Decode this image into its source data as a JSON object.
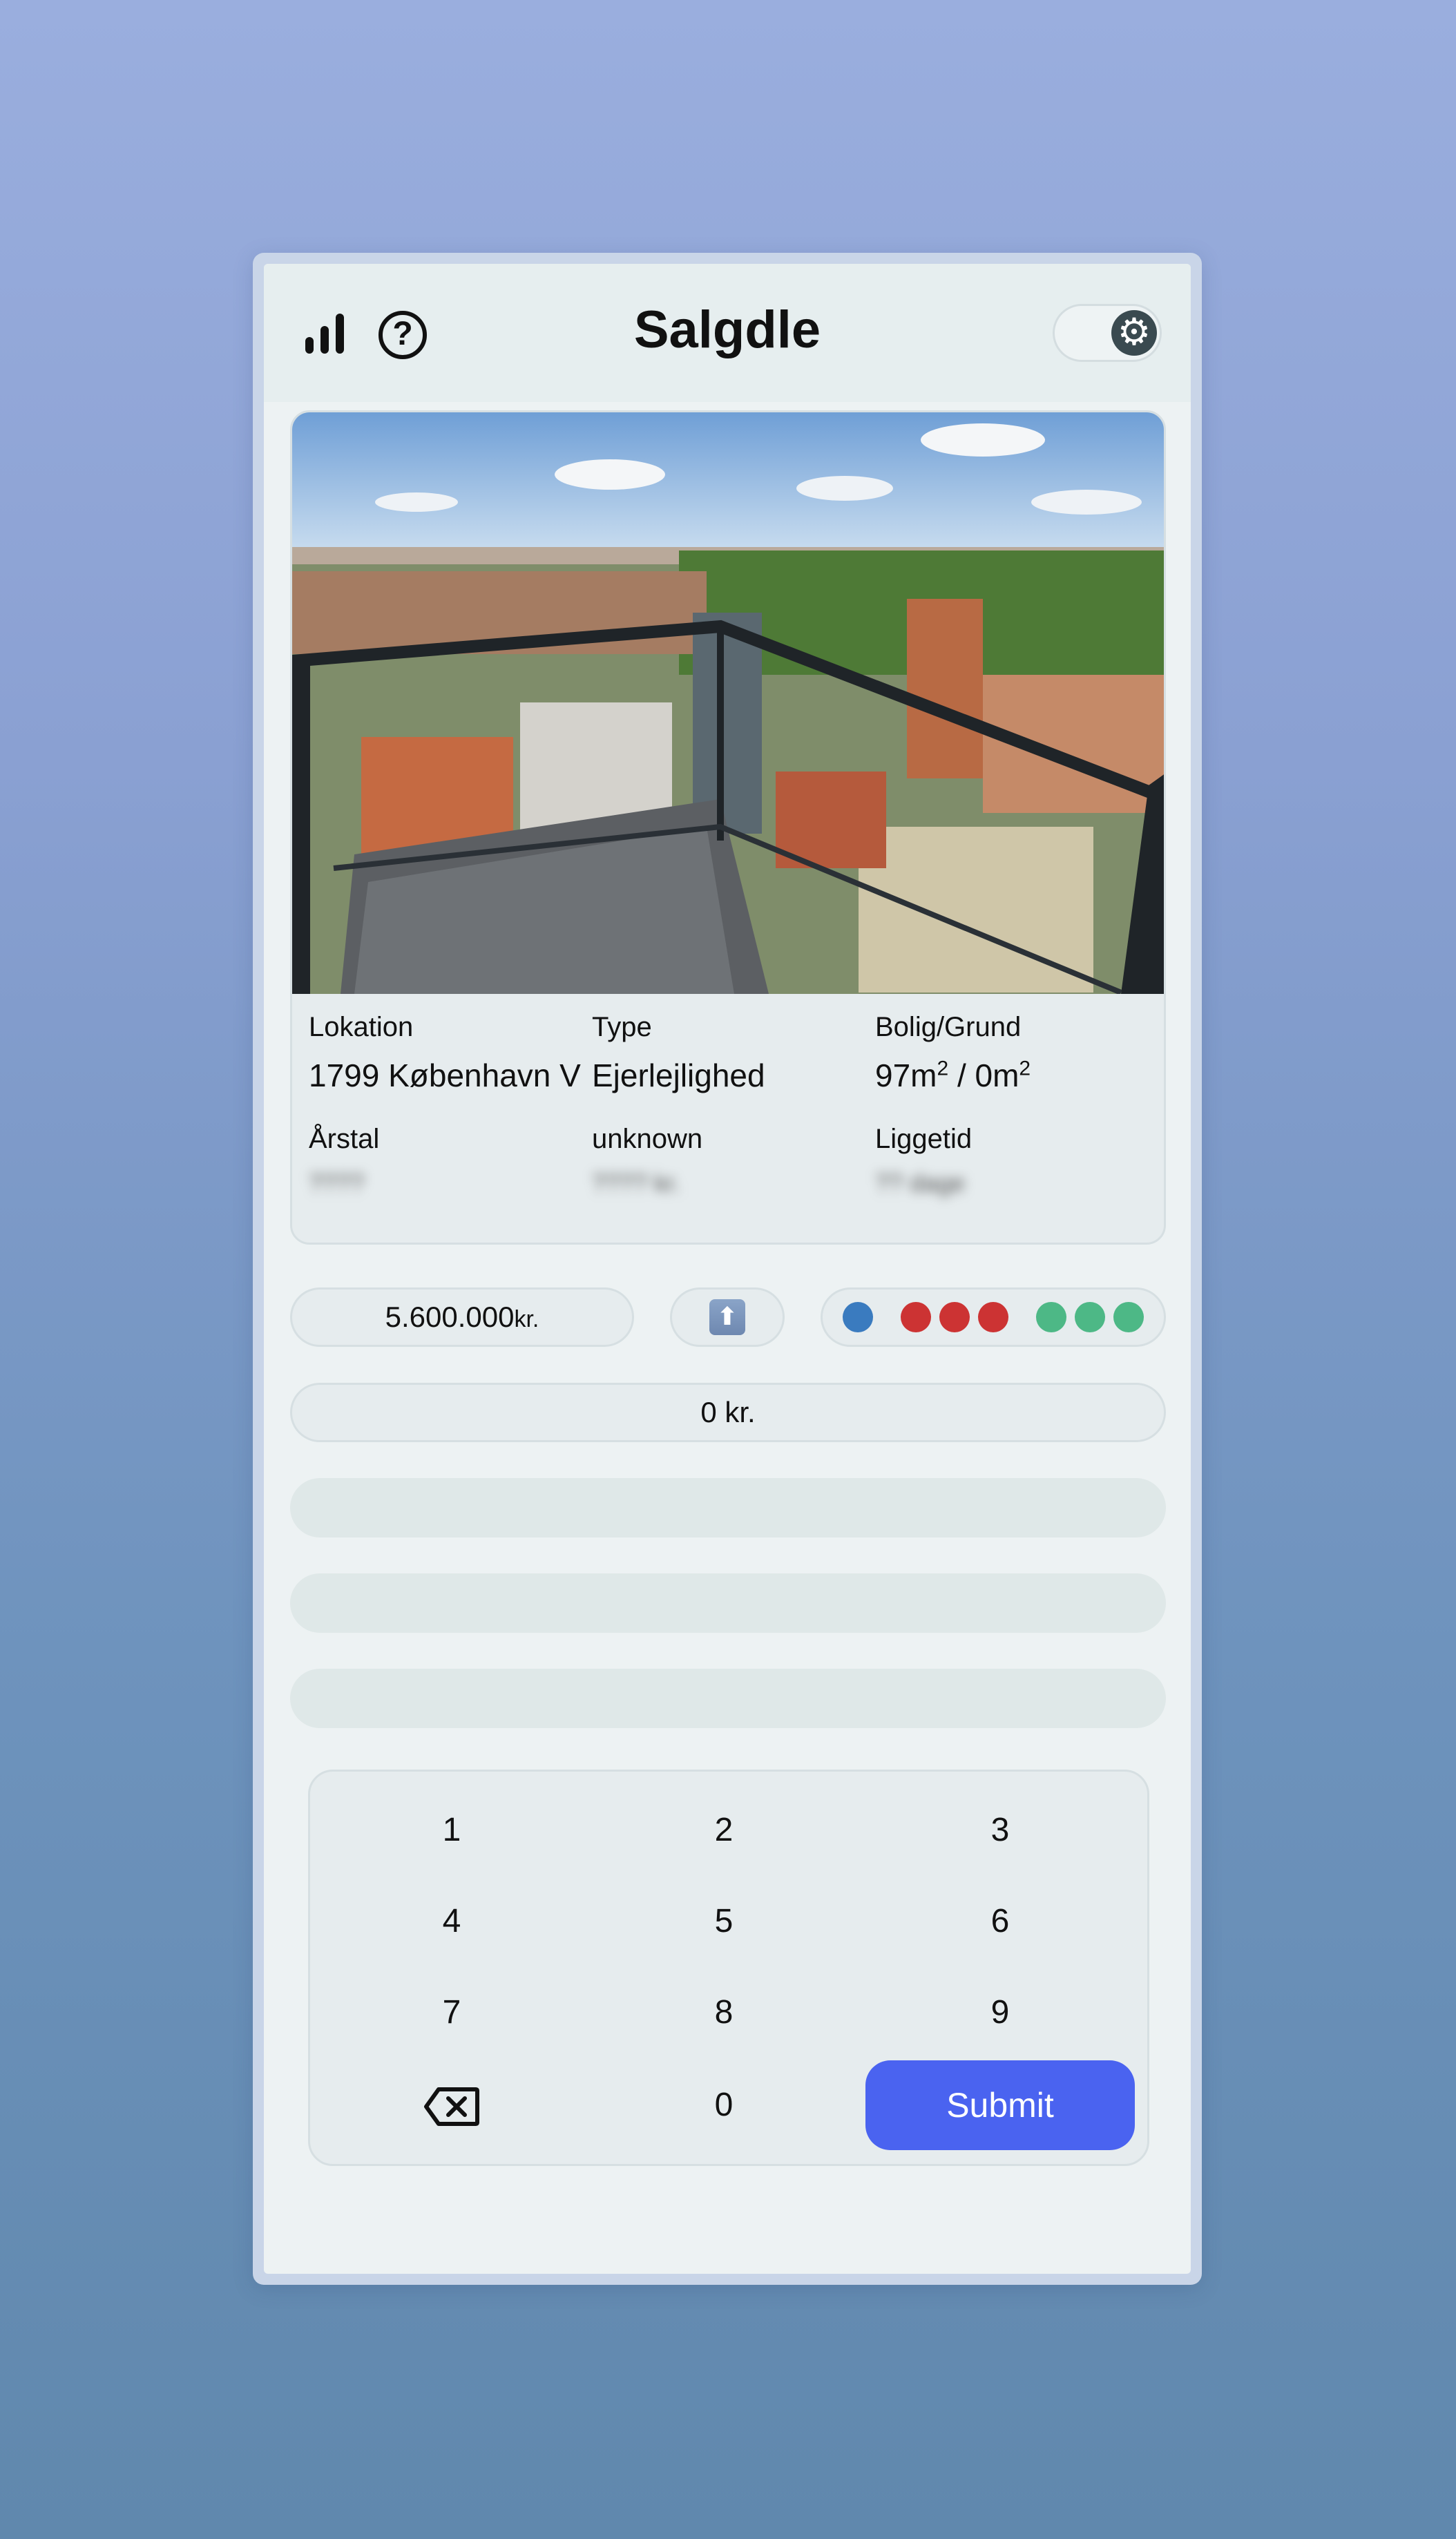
{
  "header": {
    "title": "Salgdle",
    "stats_icon": "bar-chart-icon",
    "help_icon": "question-circle-icon",
    "help_glyph": "?",
    "settings_icon": "gear-icon",
    "gear_glyph": "⚙"
  },
  "listing": {
    "photo_subject": "balcony view over city",
    "prev_icon": "chevron-left-icon",
    "next_icon": "chevron-right-icon",
    "fields": {
      "location_label": "Lokation",
      "location_value": "1799 København V",
      "type_label": "Type",
      "type_value": "Ejerlejlighed",
      "area_label": "Bolig/Grund",
      "area_living": "97m",
      "area_sep": " / ",
      "area_plot": "0m",
      "area_sup": "2",
      "year_label": "Årstal",
      "year_value": "????",
      "unknown_label": "unknown",
      "unknown_value": "???? kr.",
      "listed_label": "Liggetid",
      "listed_value": "?? dage"
    }
  },
  "stats": {
    "price": "5.600.000",
    "price_unit": "kr.",
    "hint_icon": "arrow-up-icon",
    "hint_glyph": "⬆",
    "dots": {
      "blue": [
        "#3a7bbf"
      ],
      "red": [
        "#cc3333",
        "#cc3333",
        "#cc3333"
      ],
      "green": [
        "#4db886",
        "#4db886",
        "#4db886"
      ]
    }
  },
  "guess": {
    "current": "0 kr.",
    "empty_slots": 3
  },
  "keypad": {
    "keys": [
      "1",
      "2",
      "3",
      "4",
      "5",
      "6",
      "7",
      "8",
      "9"
    ],
    "backspace_icon": "backspace-icon",
    "zero": "0",
    "submit_label": "Submit",
    "submit_color": "#4a63f0"
  }
}
